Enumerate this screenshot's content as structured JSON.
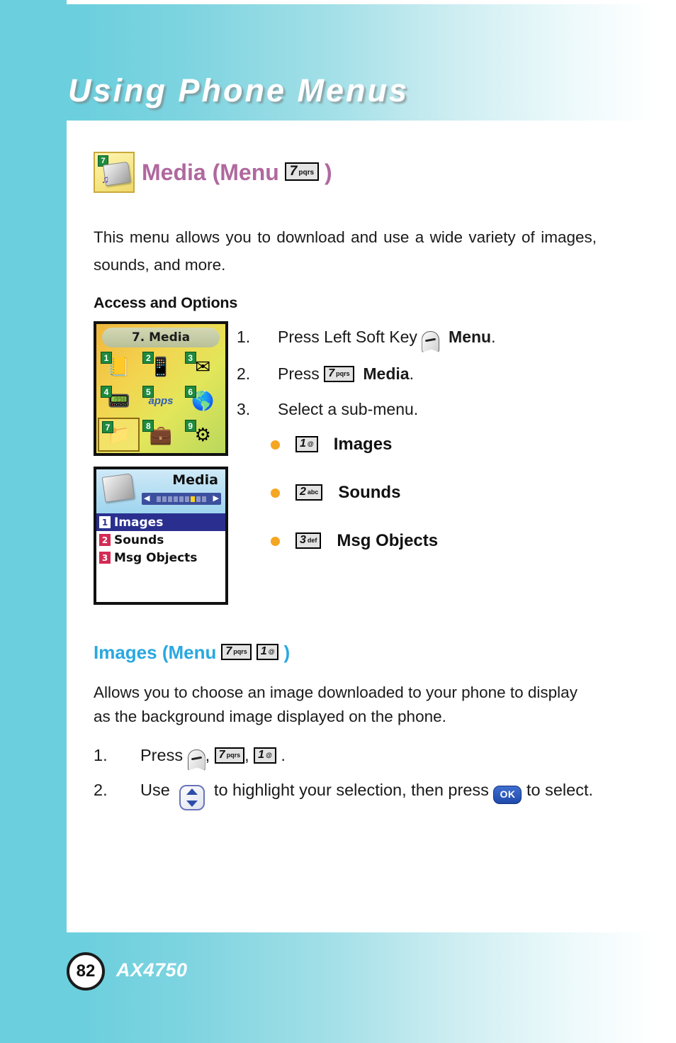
{
  "header": {
    "title": "Using Phone Menus"
  },
  "media_section": {
    "icon_name": "media-folder-icon",
    "icon_badge": "7",
    "title_prefix": "Media (Menu",
    "title_suffix": ")",
    "menu_key": {
      "digit": "7",
      "letters": "pqrs"
    },
    "intro": "This menu allows you to download and use a wide variety of images, sounds, and more.",
    "subhead": "Access and Options"
  },
  "screenshot_main_menu": {
    "title": "7. Media",
    "cells": [
      {
        "index": "1",
        "name": "contacts-icon",
        "glyph": "📒"
      },
      {
        "index": "2",
        "name": "messaging-icon",
        "glyph": "📱"
      },
      {
        "index": "3",
        "name": "mail-icon",
        "glyph": "✉"
      },
      {
        "index": "4",
        "name": "bluetooth-icon",
        "glyph": "📟"
      },
      {
        "index": "5",
        "name": "apps-icon",
        "glyph": "apps"
      },
      {
        "index": "6",
        "name": "browser-globe-icon",
        "glyph": "🌎"
      },
      {
        "index": "7",
        "name": "media-folder-icon",
        "glyph": "📁"
      },
      {
        "index": "8",
        "name": "tools-icon",
        "glyph": "💼"
      },
      {
        "index": "9",
        "name": "settings-gears-icon",
        "glyph": "⚙"
      }
    ],
    "selected_index": "7"
  },
  "screenshot_media_menu": {
    "title": "Media",
    "items": [
      {
        "index": "1",
        "label": "Images",
        "selected": true
      },
      {
        "index": "2",
        "label": "Sounds",
        "selected": false
      },
      {
        "index": "3",
        "label": "Msg Objects",
        "selected": false
      }
    ]
  },
  "steps_access": [
    {
      "num": "1.",
      "pre": "Press Left Soft Key ",
      "icon": "left-soft-key-icon",
      "bold": "Menu",
      "post": "."
    },
    {
      "num": "2.",
      "pre": "Press ",
      "key": {
        "digit": "7",
        "letters": "pqrs"
      },
      "bold": "Media",
      "post": "."
    },
    {
      "num": "3.",
      "pre": "Select a sub-menu.",
      "bold": "",
      "post": ""
    }
  ],
  "submenu_bullets": [
    {
      "key": {
        "digit": "1",
        "letters": "@"
      },
      "label": "Images"
    },
    {
      "key": {
        "digit": "2",
        "letters": "abc"
      },
      "label": "Sounds"
    },
    {
      "key": {
        "digit": "3",
        "letters": "def"
      },
      "label": "Msg Objects"
    }
  ],
  "images_section": {
    "title_prefix": "Images (Menu",
    "title_suffix": ")",
    "key_1": {
      "digit": "7",
      "letters": "pqrs"
    },
    "key_2": {
      "digit": "1",
      "letters": "@"
    },
    "paragraph": "Allows you to choose an image downloaded to your phone to display as the background image displayed on the phone.",
    "steps": [
      {
        "num": "1.",
        "part1": "Press ",
        "sep1": ",",
        "sep2": ",",
        "end": "."
      },
      {
        "num": "2.",
        "part1": "Use ",
        "part2": " to highlight your selection, then press ",
        "part3": " to select."
      }
    ]
  },
  "footer": {
    "page_number": "82",
    "model": "AX4750"
  },
  "colors": {
    "header_cyan": "#6ccfdd",
    "media_title": "#b0689e",
    "images_title": "#29a8e0",
    "bullet_orange": "#f5a623",
    "ok_key_blue": "#1f49ab"
  }
}
